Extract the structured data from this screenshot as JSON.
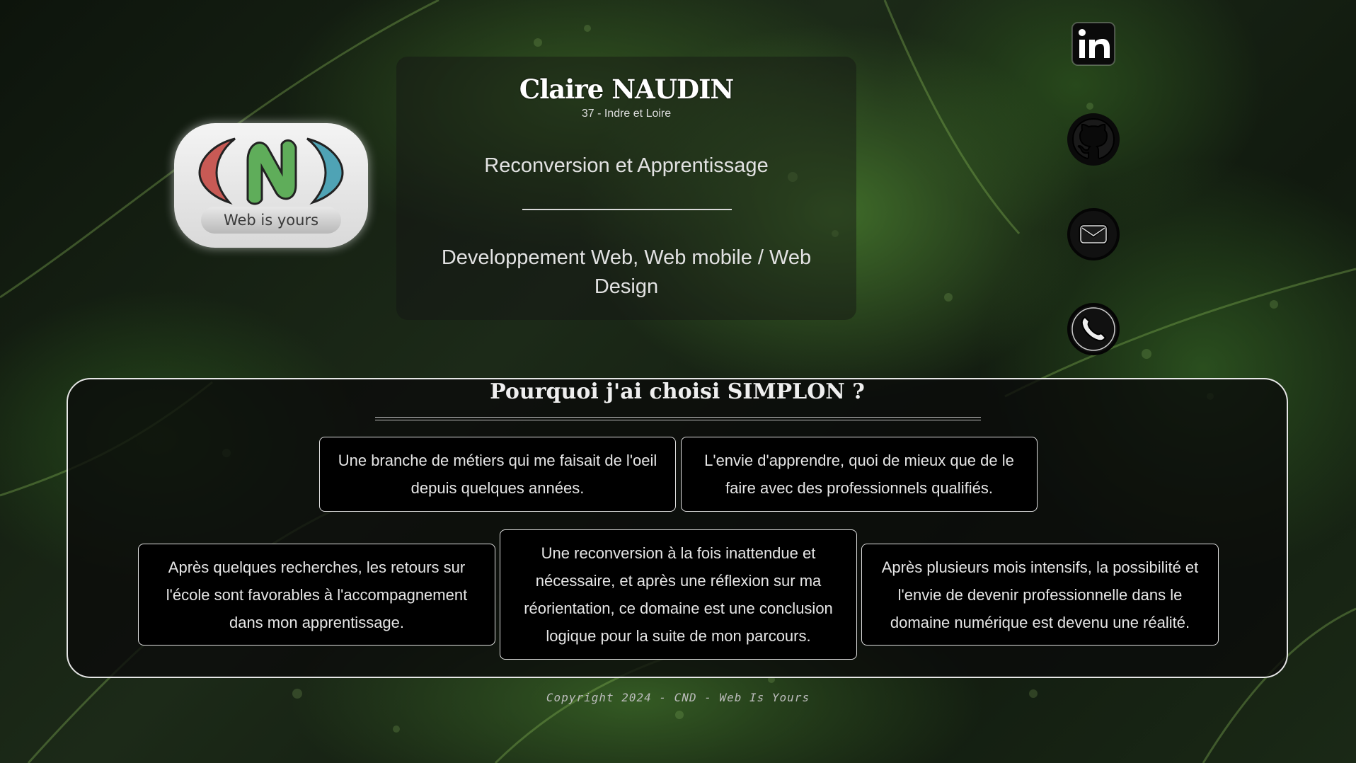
{
  "logo": {
    "caption": "Web is yours",
    "colors": {
      "left": "#c85a55",
      "center": "#5fad5a",
      "right": "#4fa3b5"
    }
  },
  "header": {
    "name": "Claire NAUDIN",
    "location": "37 - Indre et Loire",
    "subtitle": "Reconversion et Apprentissage",
    "domain": "Developpement Web, Web mobile / Web Design"
  },
  "social": [
    {
      "id": "linkedin",
      "icon": "linkedin-icon"
    },
    {
      "id": "github",
      "icon": "github-icon"
    },
    {
      "id": "email",
      "icon": "mail-icon"
    },
    {
      "id": "phone",
      "icon": "phone-icon"
    }
  ],
  "simplon": {
    "title": "Pourquoi j'ai choisi SIMPLON ?",
    "cards": [
      "Une branche de métiers qui me faisait de l'oeil depuis quelques années.",
      "L'envie d'apprendre, quoi de mieux que de le faire avec des professionnels qualifiés.",
      "Après quelques recherches, les retours sur l'école sont favorables à l'accompagnement dans mon apprentissage.",
      "Une reconversion à la fois inattendue et nécessaire, et après une réflexion sur ma réorientation, ce domaine est une conclusion logique pour la suite de mon parcours.",
      "Après plusieurs mois intensifs, la possibilité et l'envie de devenir professionnelle dans le domaine numérique est devenu une réalité."
    ]
  },
  "footer": {
    "copyright": "Copyright 2024 - CND - Web Is Yours"
  }
}
